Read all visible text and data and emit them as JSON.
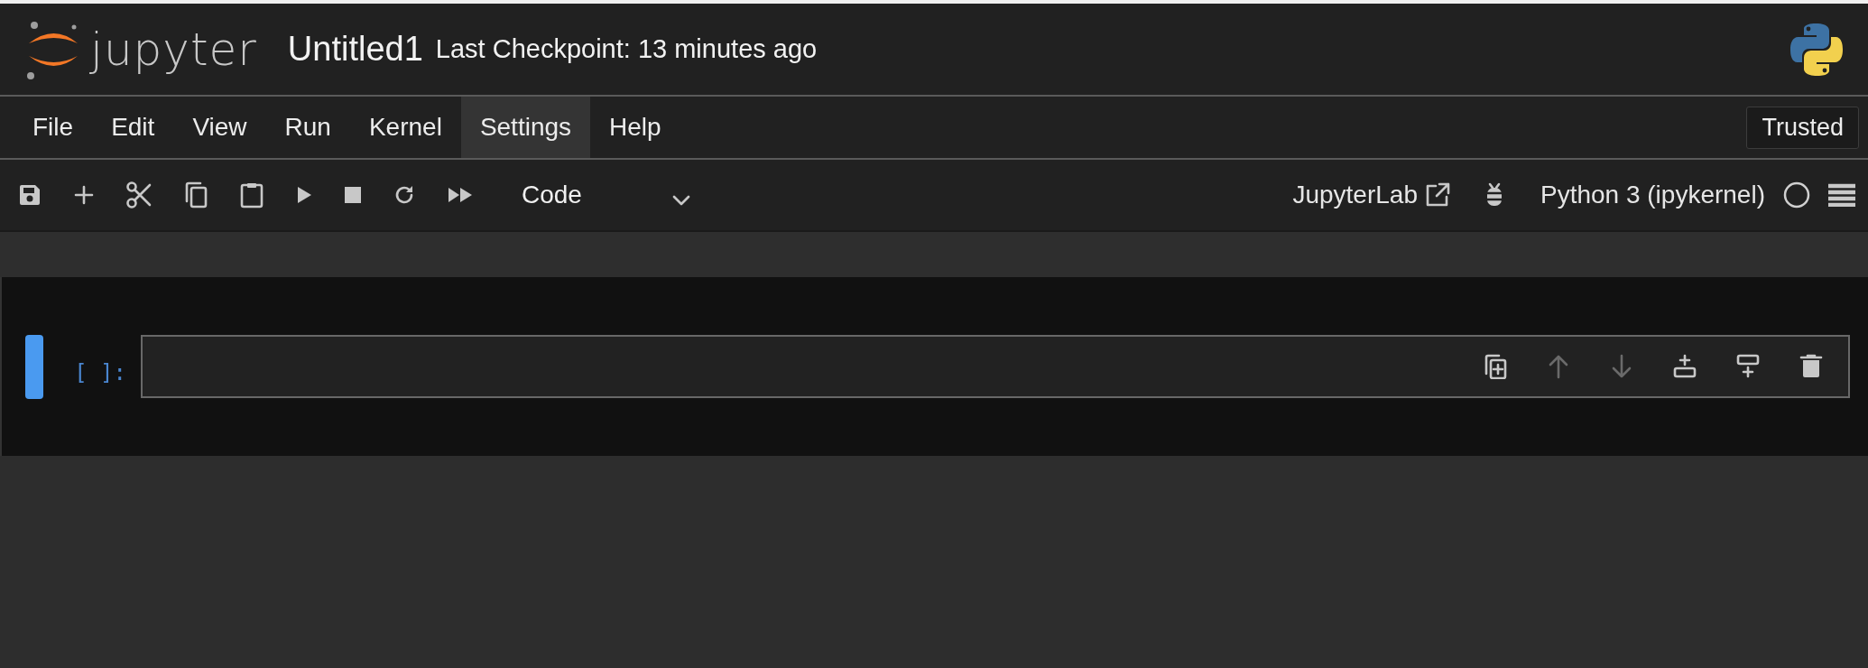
{
  "header": {
    "logo_text": "jupyter",
    "title": "Untitled1",
    "checkpoint": "Last Checkpoint: 13 minutes ago"
  },
  "menu": [
    {
      "label": "File",
      "selected": false
    },
    {
      "label": "Edit",
      "selected": false
    },
    {
      "label": "View",
      "selected": false
    },
    {
      "label": "Run",
      "selected": false
    },
    {
      "label": "Kernel",
      "selected": false
    },
    {
      "label": "Settings",
      "selected": true
    },
    {
      "label": "Help",
      "selected": false
    }
  ],
  "trusted": "Trusted",
  "toolbar": {
    "cell_type": "Code",
    "jupyterlab_link": "JupyterLab",
    "kernel": "Python 3 (ipykernel)"
  },
  "cell": {
    "active": true,
    "prompt": "[ ]:",
    "tools": [
      {
        "kind": "duplicate",
        "disabled": false
      },
      {
        "kind": "move-up",
        "disabled": true
      },
      {
        "kind": "move-down",
        "disabled": true
      },
      {
        "kind": "insert-above",
        "disabled": false
      },
      {
        "kind": "insert-below",
        "disabled": false
      },
      {
        "kind": "delete",
        "disabled": false
      }
    ]
  }
}
